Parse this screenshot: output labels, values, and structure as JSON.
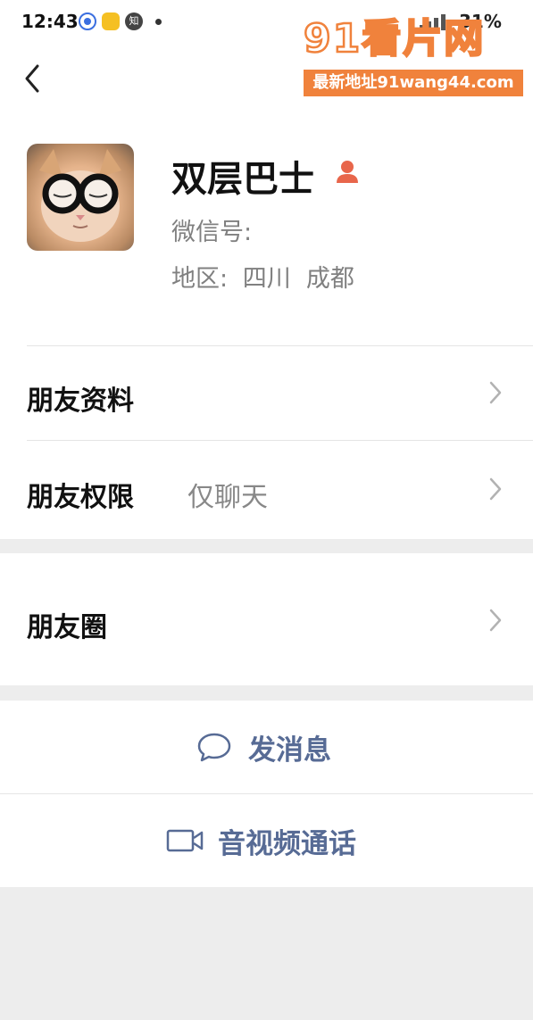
{
  "status_bar": {
    "time": "12:43",
    "app_icon_3": "知",
    "battery_text": "31%"
  },
  "watermark": {
    "title": "91看片网",
    "subtitle": "最新地址91wang44.com",
    "color": "#f0823c"
  },
  "profile": {
    "name": "双层巴士",
    "wechat_id_label": "微信号:",
    "region_label": "地区:",
    "region_value": "四川  成都"
  },
  "menu": {
    "friend_profile": "朋友资料",
    "friend_permission": "朋友权限",
    "friend_permission_value": "仅聊天",
    "moments": "朋友圈"
  },
  "actions": {
    "send_message": "发消息",
    "video_call": "音视频通话"
  },
  "colors": {
    "link": "#576b95",
    "background": "#ededed",
    "person_badge": "#e8664b"
  }
}
